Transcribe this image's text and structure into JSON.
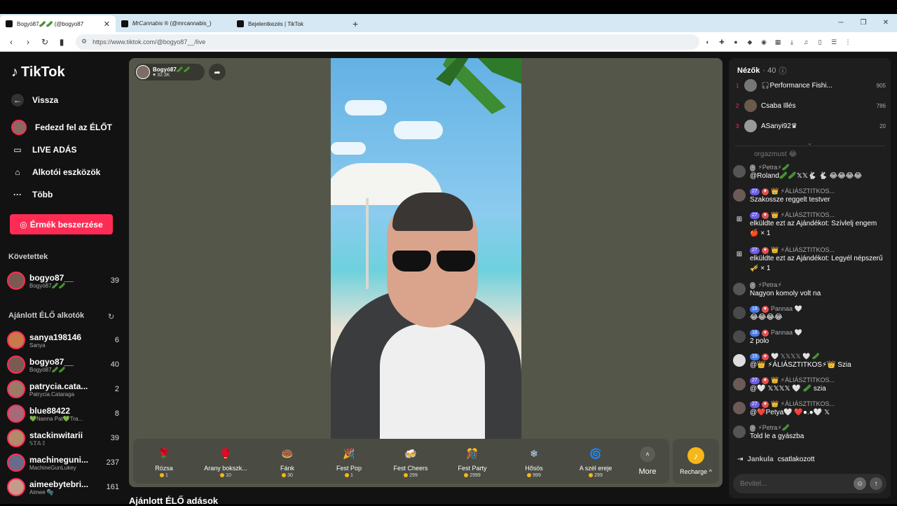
{
  "browser": {
    "tabs": [
      {
        "title": "Bogyó87🥒🥒 (@bogyo87",
        "active": true
      },
      {
        "title": "𝑀𝑟𝐶𝑎𝑛𝑛𝑎𝑏𝑖𝑠 ® (@mrcannabis_)",
        "active": false
      },
      {
        "title": "Bejelentkezés | TikTok",
        "active": false
      }
    ],
    "url": "https://www.tiktok.com/@bogyo87__/live"
  },
  "sidebar": {
    "logo": "TikTok",
    "nav": [
      {
        "label": "Vissza",
        "icon": "back-arrow-icon"
      },
      {
        "label": "Fedezd fel az ÉLŐT",
        "icon": "avatar-icon"
      },
      {
        "label": "LIVE ADÁS",
        "icon": "video-camera-icon"
      },
      {
        "label": "Alkotói eszközök",
        "icon": "home-icon"
      },
      {
        "label": "Több",
        "icon": "more-dots-icon"
      }
    ],
    "coins_button": "Érmék beszerzése",
    "following_title": "Követettek",
    "following": [
      {
        "name": "bogyo87__",
        "sub": "Bogyó87🥒🥒",
        "count": "39"
      }
    ],
    "recommended_title": "Ajánlott ÉLŐ alkotók",
    "recommended": [
      {
        "name": "sanya198146",
        "sub": "Sanya",
        "count": "6"
      },
      {
        "name": "bogyo87__",
        "sub": "Bogyó87🥒🥒",
        "count": "40"
      },
      {
        "name": "patrycia.cata...",
        "sub": "Patrycia.Cataraga",
        "count": "2"
      },
      {
        "name": "blue88422",
        "sub": "💚Nanna Pat💚Tra...",
        "count": "8"
      },
      {
        "name": "stackinwitarii",
        "sub": "𝕊𝕋𝔸 𝕀",
        "count": "39"
      },
      {
        "name": "machineguni...",
        "sub": "MachineGunLukey",
        "count": "237"
      },
      {
        "name": "aimeebytebri...",
        "sub": "Aimee 🫧",
        "count": "161"
      }
    ],
    "bottom_title": "Ajánlott ÉLŐ adások"
  },
  "stream": {
    "host_name": "Bogyó87🥒🥒",
    "host_likes": "♥ 32.3K",
    "gifts": [
      {
        "name": "Rózsa",
        "price": "1",
        "emoji": "🌹",
        "color": "#c0233a"
      },
      {
        "name": "Arany bokszk...",
        "price": "10",
        "emoji": "🥊",
        "color": "#e9c24a"
      },
      {
        "name": "Fánk",
        "price": "30",
        "emoji": "🍩",
        "color": "#f08fb0"
      },
      {
        "name": "Fest Pop",
        "price": "1",
        "emoji": "🎉",
        "color": "#3a2a6a"
      },
      {
        "name": "Fest Cheers",
        "price": "299",
        "emoji": "🍻",
        "color": "#5b3d8c"
      },
      {
        "name": "Fest Party",
        "price": "2999",
        "emoji": "🎊",
        "color": "#7a2f8c"
      },
      {
        "name": "Hősös",
        "price": "999",
        "emoji": "❄",
        "color": "#8fbbe8"
      },
      {
        "name": "A szél ereje",
        "price": "299",
        "emoji": "🌀",
        "color": "#6e7be8"
      }
    ],
    "more_label": "More",
    "recharge_label": "Recharge ^"
  },
  "panel": {
    "viewers_title": "Nézők",
    "viewers_count": "· 40",
    "top_viewers": [
      {
        "rank": "1",
        "name": "🎧Performance Fishi...",
        "score": "905"
      },
      {
        "rank": "2",
        "name": "Csaba Illés",
        "score": "786"
      },
      {
        "rank": "3",
        "name": "ASanyi92♛",
        "score": "20"
      }
    ],
    "faded_text": "orgazmust 😂",
    "messages": [
      {
        "type": "user",
        "user": "⚡Petra⚡🥒",
        "level": "",
        "text": "@Roland🥒🥒𝕏𝕏🐇 🐇 😂😂😂😂"
      },
      {
        "type": "user",
        "user": "👑 ⚡ÁLIÁSZTITKOS...",
        "level": "27",
        "text": "Szakossze reggelt testver"
      },
      {
        "type": "gift",
        "user": "👑 ⚡ÁLIÁSZTITKOS...",
        "level": "27",
        "text": "elküldte ezt az Ajándékot: Szívlelj engem 🍎 × 1"
      },
      {
        "type": "gift",
        "user": "👑 ⚡ÁLIÁSZTITKOS...",
        "level": "27",
        "text": "elküldte ezt az Ajándékot: Legyél népszerű 🎺 × 1"
      },
      {
        "type": "user",
        "user": "⚡Petra⚡",
        "level": "",
        "text": "Nagyon komoly volt na"
      },
      {
        "type": "user",
        "user": "Pannaa 🤍",
        "level": "18",
        "text": "😂😂😂😂"
      },
      {
        "type": "user",
        "user": "Pannaa 🤍",
        "level": "18",
        "text": "2 polo"
      },
      {
        "type": "user",
        "user": "🤍 𝕏𝕏𝕏𝕏 🤍 🥒",
        "level": "15",
        "text": "@👑 ⚡ÁLIÁSZTITKOS⚡👑 Szia"
      },
      {
        "type": "user",
        "user": "👑 ⚡ÁLIÁSZTITKOS...",
        "level": "27",
        "text": "@🤍 𝕏𝕏𝕏𝕏 🤍 🥒 szia"
      },
      {
        "type": "user",
        "user": "👑 ⚡ÁLIÁSZTITKOS...",
        "level": "27",
        "text": "@❤️Petya🤍 ❤️●.●🤍 𝕏"
      },
      {
        "type": "user",
        "user": "⚡Petra⚡🥒",
        "level": "",
        "text": "Told le a gyászba"
      }
    ],
    "join_user": "Jankula",
    "join_text": "csatlakozott",
    "input_placeholder": "Bevitel..."
  }
}
